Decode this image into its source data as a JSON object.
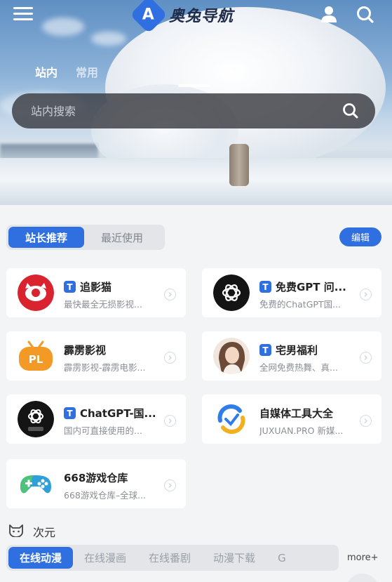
{
  "header": {
    "logo_letter": "A",
    "site_name": "奥兔导航",
    "icons": [
      "menu-icon",
      "user-icon",
      "search-icon"
    ]
  },
  "search": {
    "tabs": [
      {
        "label": "站内",
        "active": true
      },
      {
        "label": "常用",
        "active": false
      }
    ],
    "placeholder": "站内搜索"
  },
  "recommend": {
    "tabs": [
      {
        "label": "站长推荐",
        "active": true
      },
      {
        "label": "最近使用",
        "active": false
      }
    ],
    "edit_label": "编辑",
    "cards": [
      {
        "title": "追影猫",
        "badge": "T",
        "desc": "最快最全无损影视...",
        "icon": "cat-logo-icon",
        "color": "#d9232f"
      },
      {
        "title": "免费GPT 问...",
        "badge": "T",
        "desc": "免费的ChatGPT国...",
        "icon": "openai-icon",
        "color": "#1a1a1a"
      },
      {
        "title": "霹雳影视",
        "badge": "",
        "desc": "霹雳影视-霹雳电影...",
        "icon": "pl-tv-icon",
        "color": "#f29a25"
      },
      {
        "title": "宅男福利",
        "badge": "T",
        "desc": "全网免费热舞、真...",
        "icon": "avatar-photo-icon",
        "color": "#e9d5c8"
      },
      {
        "title": "ChatGPT-国...",
        "badge": "T",
        "desc": "国内可直接使用的...",
        "icon": "openai-tool-icon",
        "color": "#1a1a1a"
      },
      {
        "title": "自媒体工具大全",
        "badge": "",
        "desc": "JUXUAN.PRO 新媒...",
        "icon": "juxuan-icon",
        "color": "#2f7de8"
      },
      {
        "title": "668游戏仓库",
        "badge": "",
        "desc": "668游戏仓库–全球...",
        "icon": "gamepad-icon",
        "color": "#2e9fd9"
      }
    ]
  },
  "ciyuan": {
    "title": "次元",
    "categories": [
      {
        "label": "在线动漫",
        "active": true
      },
      {
        "label": "在线漫画",
        "active": false
      },
      {
        "label": "在线番剧",
        "active": false
      },
      {
        "label": "动漫下载",
        "active": false
      },
      {
        "label": "G",
        "active": false
      }
    ],
    "more_label": "more+"
  },
  "colors": {
    "accent": "#2f6fe0",
    "background": "#f3f4f6"
  }
}
